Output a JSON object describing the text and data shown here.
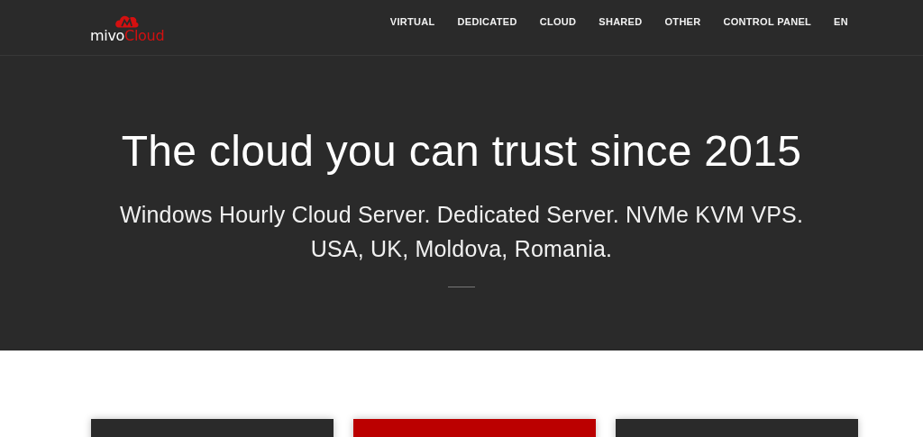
{
  "logo": {
    "prefix": "mivo",
    "suffix": "Cloud"
  },
  "nav": [
    {
      "label": "VIRTUAL"
    },
    {
      "label": "DEDICATED"
    },
    {
      "label": "CLOUD"
    },
    {
      "label": "SHARED"
    },
    {
      "label": "OTHER"
    },
    {
      "label": "CONTROL PANEL"
    },
    {
      "label": "EN"
    }
  ],
  "hero": {
    "title": "The cloud you can trust since 2015",
    "subtitle_lines": [
      "Windows Hourly Cloud Server. Dedicated Server. NVMe KVM VPS.",
      "USA, UK, Moldova, Romania."
    ]
  },
  "cards": [
    {
      "color": "#2a2a2a"
    },
    {
      "color": "#bb0000"
    },
    {
      "color": "#2a2a2a"
    }
  ]
}
